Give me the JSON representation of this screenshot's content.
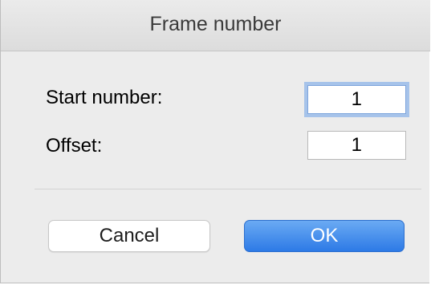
{
  "dialog": {
    "title": "Frame number",
    "fields": {
      "start_label": "Start number:",
      "start_value": "1",
      "offset_label": "Offset:",
      "offset_value": "1"
    },
    "buttons": {
      "cancel_label": "Cancel",
      "ok_label": "OK"
    }
  },
  "colors": {
    "window_bg": "#ececec",
    "focus_ring": "#a6c3ea",
    "ok_button": "#3d88ec"
  }
}
